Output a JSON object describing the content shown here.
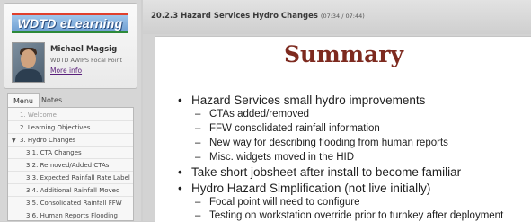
{
  "sidebar": {
    "logo_text": "WDTD eLearning",
    "presenter": {
      "name": "Michael Magsig",
      "title": "WDTD AWIPS Focal Point",
      "more_info": "More info"
    },
    "tabs": [
      {
        "label": "Menu",
        "active": true
      },
      {
        "label": "Notes",
        "active": false
      }
    ],
    "menu_items": [
      {
        "label": "1. Welcome",
        "state": "dimmed"
      },
      {
        "label": "2. Learning Objectives",
        "state": "normal"
      },
      {
        "label": "3. Hydro Changes",
        "state": "expanded"
      },
      {
        "label": "3.1. CTA Changes",
        "state": "normal"
      },
      {
        "label": "3.2. Removed/Added CTAs",
        "state": "normal"
      },
      {
        "label": "3.3. Expected Rainfall Rate Label",
        "state": "normal"
      },
      {
        "label": "3.4. Additional Rainfall Moved",
        "state": "normal"
      },
      {
        "label": "3.5. Consolidated Rainfall FFW",
        "state": "normal"
      },
      {
        "label": "3.6. Human Reports Flooding",
        "state": "normal"
      }
    ]
  },
  "header": {
    "title": "20.2.3 Hazard Services Hydro Changes",
    "time": "(07:34 / 07:44)"
  },
  "slide": {
    "title": "Summary",
    "bullets": [
      {
        "level": 1,
        "marker": "•",
        "text": "Hazard Services small hydro improvements"
      },
      {
        "level": 2,
        "marker": "–",
        "text": "CTAs added/removed"
      },
      {
        "level": 2,
        "marker": "–",
        "text": "FFW consolidated rainfall information"
      },
      {
        "level": 2,
        "marker": "–",
        "text": "New way for describing flooding from human reports"
      },
      {
        "level": 2,
        "marker": "–",
        "text": "Misc. widgets moved in the HID"
      },
      {
        "level": 1,
        "marker": "•",
        "text": "Take short jobsheet after install to become familiar"
      },
      {
        "level": 1,
        "marker": "•",
        "text": "Hydro Hazard Simplification (not live initially)"
      },
      {
        "level": 2,
        "marker": "–",
        "text": "Focal point will need to configure"
      },
      {
        "level": 2,
        "marker": "–",
        "text": "Testing on workstation override prior to turnkey after deployment"
      }
    ]
  },
  "colors": {
    "summary_title": "#7d2a1f",
    "link": "#5a1f7a"
  }
}
